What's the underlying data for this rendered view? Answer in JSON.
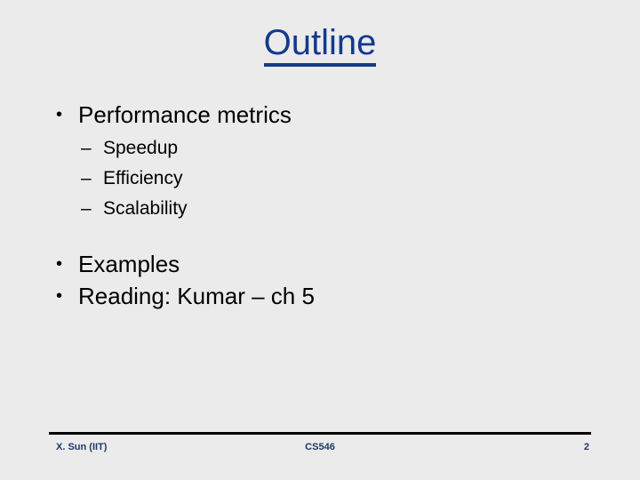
{
  "slide": {
    "title": "Outline",
    "accent_color": "#123a8c",
    "background_color": "#ebebeb",
    "text_color": "#000000",
    "bullets": [
      {
        "level": 1,
        "marker": "•",
        "text": "Performance metrics"
      },
      {
        "level": 2,
        "marker": "–",
        "text": "Speedup"
      },
      {
        "level": 2,
        "marker": "–",
        "text": "Efficiency"
      },
      {
        "level": 2,
        "marker": "–",
        "text": "Scalability"
      },
      {
        "level": 1,
        "marker": "•",
        "text": "Examples"
      },
      {
        "level": 1,
        "marker": "•",
        "text": "Reading: Kumar – ch 5"
      }
    ]
  },
  "footer": {
    "left": "X. Sun (IIT)",
    "center": "CS546",
    "page_number": "2",
    "text_color": "#1f3864"
  }
}
